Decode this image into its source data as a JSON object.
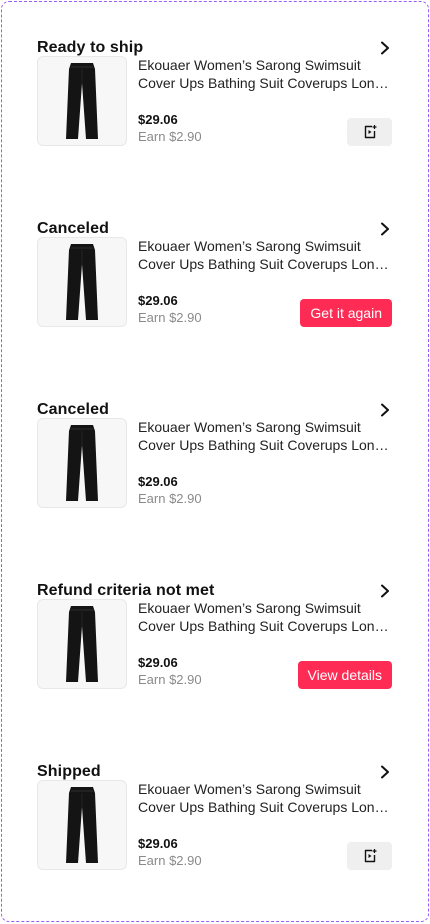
{
  "orders": [
    {
      "status": "Ready to ship",
      "product_title": "Ekouaer Women’s Sarong Swimsuit Cover Ups Bathing Suit Coverups Long Pants",
      "price": "$29.06",
      "earn": "Earn $2.90",
      "action": {
        "kind": "icon",
        "icon": "add-to-showcase-icon"
      }
    },
    {
      "status": "Canceled",
      "product_title": "Ekouaer Women’s Sarong Swimsuit Cover Ups Bathing Suit Coverups Long Pants",
      "price": "$29.06",
      "earn": "Earn $2.90",
      "action": {
        "kind": "button",
        "label": "Get it again"
      }
    },
    {
      "status": "Canceled",
      "product_title": "Ekouaer Women’s Sarong Swimsuit Cover Ups Bathing Suit Coverups Long Pants",
      "price": "$29.06",
      "earn": "Earn $2.90",
      "action": {
        "kind": "none"
      }
    },
    {
      "status": "Refund criteria not met",
      "product_title": "Ekouaer Women’s Sarong Swimsuit Cover Ups Bathing Suit Coverups Long Pants",
      "price": "$29.06",
      "earn": "Earn $2.90",
      "action": {
        "kind": "button",
        "label": "View details"
      }
    },
    {
      "status": "Shipped",
      "product_title": "Ekouaer Women’s Sarong Swimsuit Cover Ups Bathing Suit Coverups Long Pants",
      "price": "$29.06",
      "earn": "Earn $2.90",
      "action": {
        "kind": "icon",
        "icon": "add-to-showcase-icon"
      }
    }
  ],
  "colors": {
    "cta_background": "#fe2c55",
    "cta_text": "#ffffff",
    "icon_button_background": "#efefef",
    "earn_text": "#8a8a8a"
  }
}
